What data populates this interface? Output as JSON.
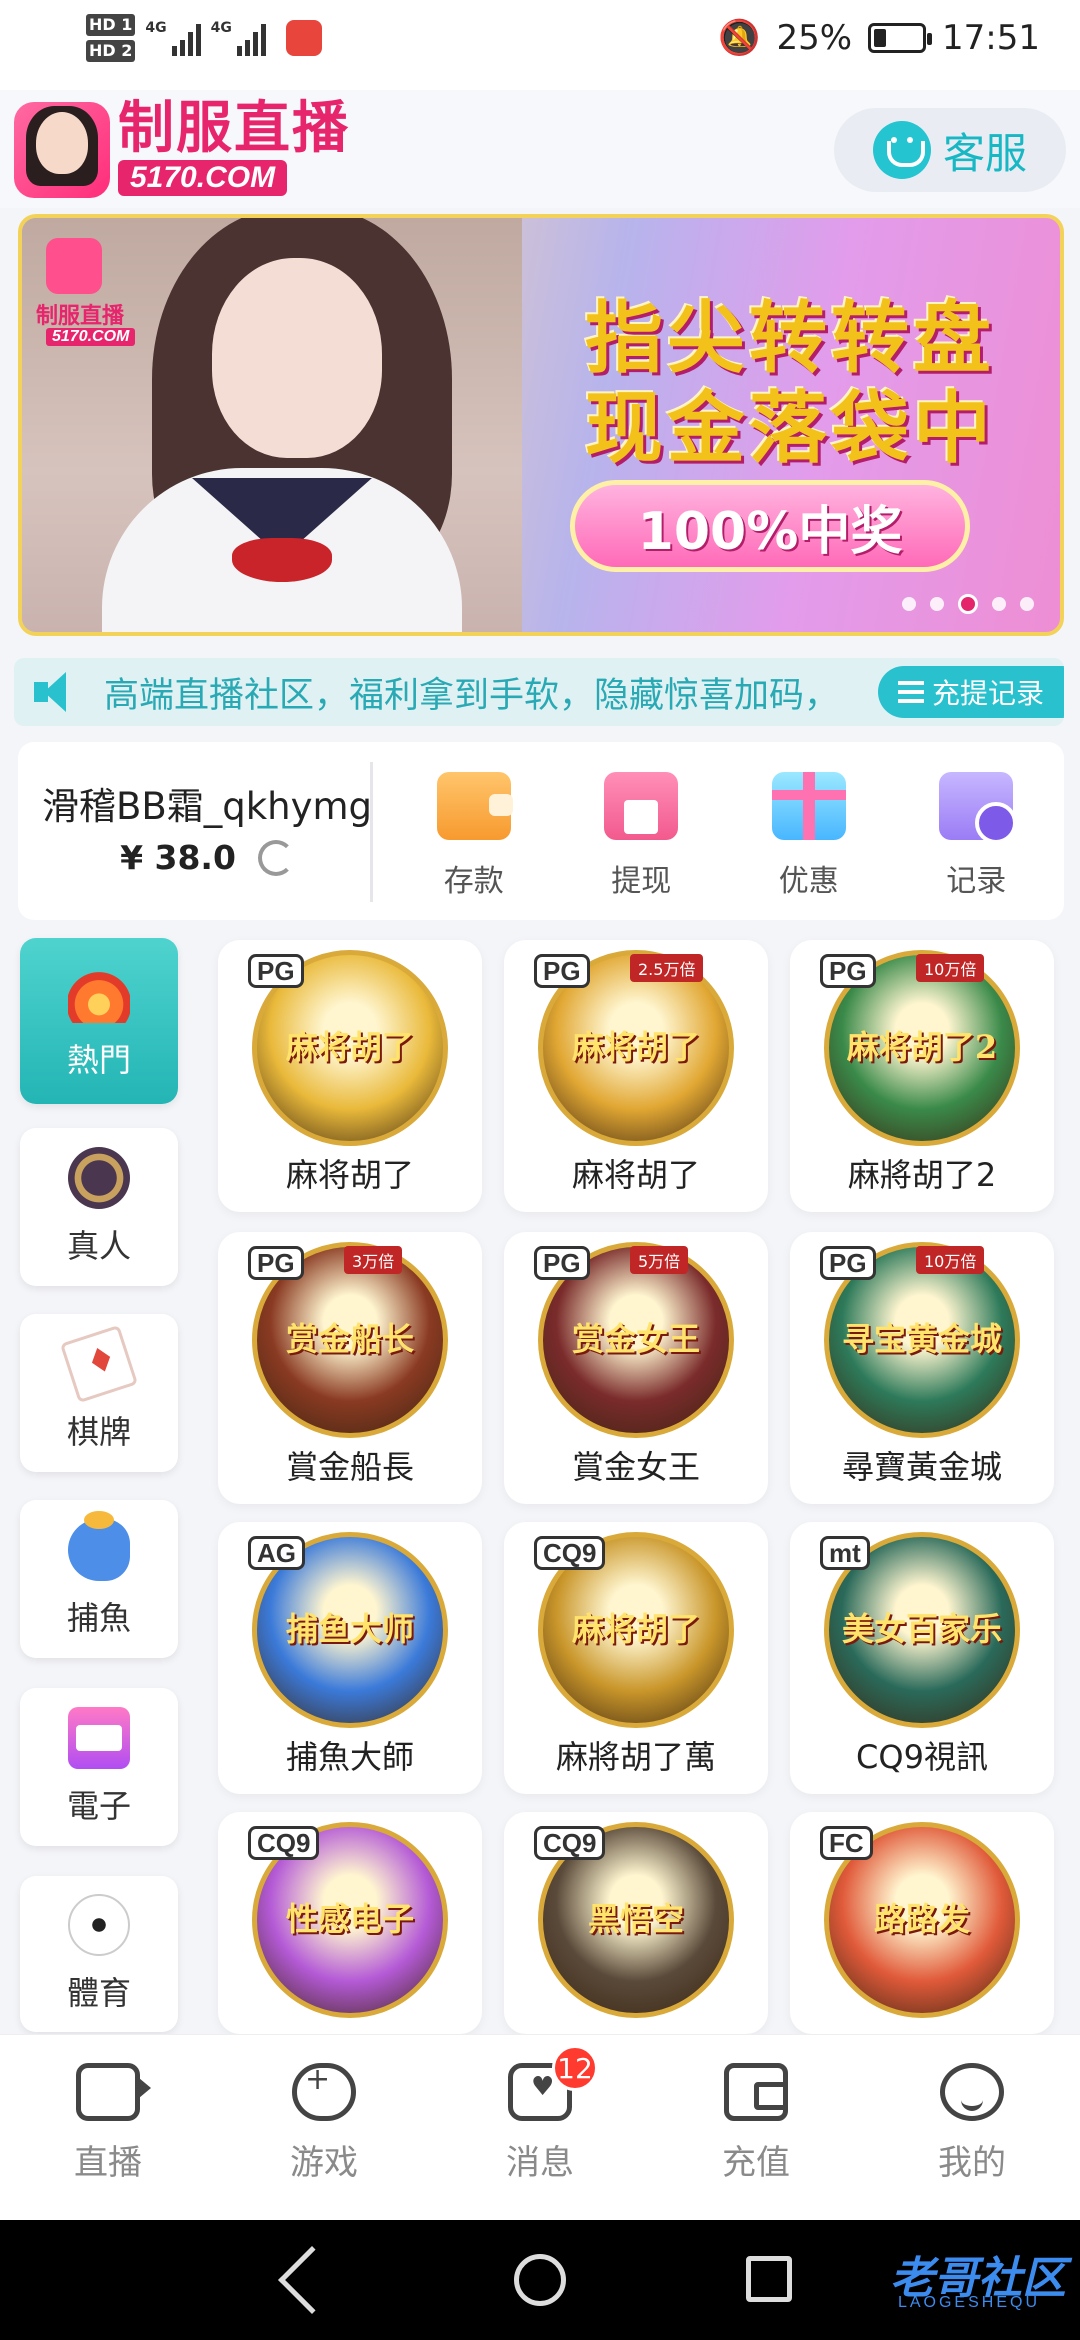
{
  "status_bar": {
    "hd1": "HD 1",
    "hd2": "HD 2",
    "net1": "4G",
    "net2": "4G",
    "battery": "25%",
    "time": "17:51",
    "battery_level": 0.25
  },
  "header": {
    "logo_title": "制服直播",
    "logo_domain": "5170.COM",
    "support_label": "客服"
  },
  "banner": {
    "line1": "指尖转转盘",
    "line2": "现金落袋中",
    "pill": "100%中奖",
    "logo_title": "制服直播",
    "logo_domain": "5170.COM",
    "slide_count": 5,
    "active_slide": 3
  },
  "marquee": {
    "text": "高端直播社区，福利拿到手软，隐藏惊喜加码，",
    "record_button": "充提记录"
  },
  "account": {
    "username": "滑稽BB霜_qkhymg",
    "balance": "¥ 38.0",
    "actions": [
      {
        "label": "存款",
        "icon": "wallet-icon"
      },
      {
        "label": "提现",
        "icon": "atm-icon"
      },
      {
        "label": "优惠",
        "icon": "gift-icon"
      },
      {
        "label": "记录",
        "icon": "folder-clock-icon"
      }
    ]
  },
  "categories": [
    {
      "label": "熱門",
      "icon": "fire-icon",
      "active": true
    },
    {
      "label": "真人",
      "icon": "casino-chip-icon"
    },
    {
      "label": "棋牌",
      "icon": "poker-card-icon"
    },
    {
      "label": "捕魚",
      "icon": "fish-icon"
    },
    {
      "label": "電子",
      "icon": "slot-machine-icon"
    },
    {
      "label": "體育",
      "icon": "soccer-ball-icon"
    }
  ],
  "games": [
    {
      "name": "麻将胡了",
      "provider": "PG",
      "badge": "",
      "thumb_text": "麻将胡了",
      "color": "#e9b93a"
    },
    {
      "name": "麻将胡了",
      "provider": "PG",
      "badge": "2.5万倍",
      "thumb_text": "麻将胡了",
      "color": "#e1a733"
    },
    {
      "name": "麻將胡了2",
      "provider": "PG",
      "badge": "10万倍",
      "thumb_text": "麻将胡了2",
      "color": "#3a8a4a"
    },
    {
      "name": "賞金船長",
      "provider": "PG",
      "badge": "3万倍",
      "thumb_text": "赏金船长",
      "color": "#8a3a22"
    },
    {
      "name": "賞金女王",
      "provider": "PG",
      "badge": "5万倍",
      "thumb_text": "赏金女王",
      "color": "#7a2b2b"
    },
    {
      "name": "尋寶黃金城",
      "provider": "PG",
      "badge": "10万倍",
      "thumb_text": "寻宝黄金城",
      "color": "#2d7a5a"
    },
    {
      "name": "捕魚大師",
      "provider": "AG",
      "badge": "",
      "thumb_text": "捕鱼大师",
      "color": "#3b7ad9"
    },
    {
      "name": "麻將胡了萬",
      "provider": "CQ9",
      "badge": "",
      "thumb_text": "麻将胡了",
      "color": "#c9962a"
    },
    {
      "name": "CQ9視訊",
      "provider": "mt",
      "badge": "",
      "thumb_text": "美女百家乐",
      "color": "#2a6a5a"
    },
    {
      "name": "",
      "provider": "CQ9",
      "badge": "",
      "thumb_text": "性感电子",
      "color": "#b45ad6"
    },
    {
      "name": "",
      "provider": "CQ9",
      "badge": "",
      "thumb_text": "黑悟空",
      "color": "#5a4a3a"
    },
    {
      "name": "",
      "provider": "FC",
      "badge": "",
      "thumb_text": "路路发",
      "color": "#e05a3a"
    }
  ],
  "tabbar": [
    {
      "label": "直播",
      "icon": "live-camera-icon"
    },
    {
      "label": "游戏",
      "icon": "gamepad-icon"
    },
    {
      "label": "消息",
      "icon": "message-icon",
      "badge": "12"
    },
    {
      "label": "充值",
      "icon": "wallet-icon"
    },
    {
      "label": "我的",
      "icon": "smile-face-icon"
    }
  ],
  "watermark": {
    "text": "老哥社区",
    "sub": "LAOGESHEQU"
  }
}
